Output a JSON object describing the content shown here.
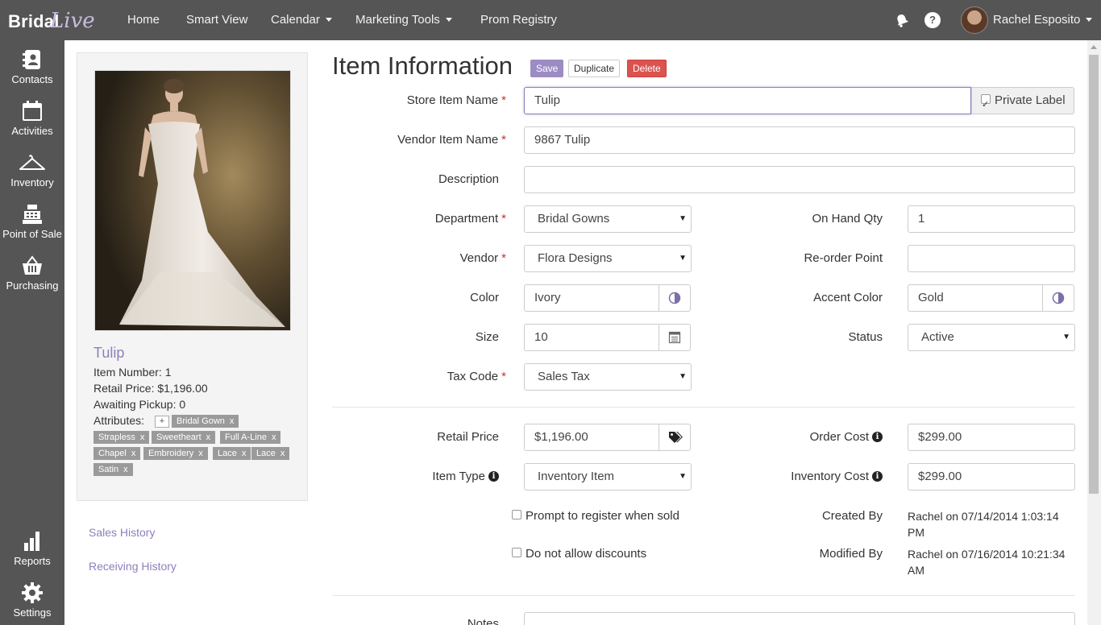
{
  "app": {
    "logo_bridal": "Bridal",
    "logo_live": "Live"
  },
  "nav": {
    "home": "Home",
    "smart_view": "Smart View",
    "calendar": "Calendar",
    "marketing_tools": "Marketing Tools",
    "prom_registry": "Prom Registry",
    "user_name": "Rachel Esposito",
    "help_glyph": "?"
  },
  "sidebar": {
    "contacts": "Contacts",
    "activities": "Activities",
    "inventory": "Inventory",
    "point_of_sale": "Point of Sale",
    "purchasing": "Purchasing",
    "reports": "Reports",
    "settings": "Settings"
  },
  "card": {
    "name": "Tulip",
    "item_number": "Item Number: 1",
    "retail_price": "Retail Price: $1,196.00",
    "awaiting_pickup": "Awaiting Pickup: 0",
    "attributes_label": "Attributes:",
    "add_glyph": "+",
    "remove_glyph": "x",
    "tags": [
      "Bridal Gown",
      "Strapless",
      "Sweetheart",
      "Full A-Line",
      "Chapel",
      "Embroidery",
      "Lace",
      "Lace",
      "Satin"
    ]
  },
  "links": {
    "sales_history": "Sales History",
    "receiving_history": "Receiving History"
  },
  "form": {
    "title": "Item Information",
    "save": "Save",
    "duplicate": "Duplicate",
    "delete": "Delete",
    "required_mark": "*",
    "store_item_name_label": "Store Item Name",
    "store_item_name": "Tulip",
    "private_label": "Private Label",
    "private_label_checked": true,
    "vendor_item_name_label": "Vendor Item Name",
    "vendor_item_name": "9867 Tulip",
    "description_label": "Description",
    "description": "",
    "department_label": "Department",
    "department": "Bridal Gowns",
    "on_hand_qty_label": "On Hand Qty",
    "on_hand_qty": "1",
    "vendor_label": "Vendor",
    "vendor": "Flora Designs",
    "reorder_point_label": "Re-order Point",
    "reorder_point": "",
    "color_label": "Color",
    "color": "Ivory",
    "accent_color_label": "Accent Color",
    "accent_color": "Gold",
    "size_label": "Size",
    "size": "10",
    "status_label": "Status",
    "status": "Active",
    "tax_code_label": "Tax Code",
    "tax_code": "Sales Tax",
    "retail_price_label": "Retail Price",
    "retail_price": "$1,196.00",
    "order_cost_label": "Order Cost",
    "order_cost": "$299.00",
    "item_type_label": "Item Type",
    "item_type": "Inventory Item",
    "inventory_cost_label": "Inventory Cost",
    "inventory_cost": "$299.00",
    "prompt_register": "Prompt to register when sold",
    "no_discounts": "Do not allow discounts",
    "created_by_label": "Created By",
    "created_by_line1": "Rachel on 07/14/2014 1:03:14",
    "created_by_line2": "PM",
    "modified_by_label": "Modified By",
    "modified_by_line1": "Rachel on 07/16/2014 10:21:34",
    "modified_by_line2": "AM",
    "notes_label": "Notes",
    "info_glyph": "i",
    "select_arrow": "▼"
  },
  "colors": {
    "accent": "#9d8cc4",
    "link": "#8f7fba",
    "danger": "#d9534f",
    "chrome": "#555555"
  }
}
